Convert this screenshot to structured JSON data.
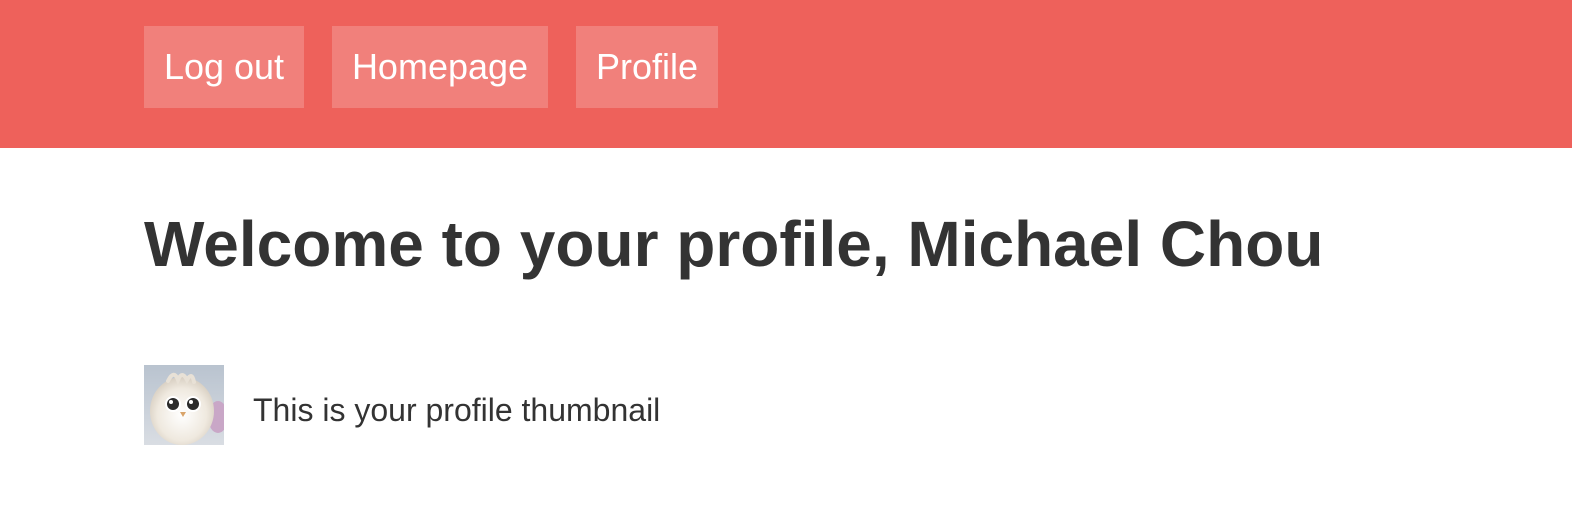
{
  "nav": {
    "logout_label": "Log out",
    "homepage_label": "Homepage",
    "profile_label": "Profile"
  },
  "main": {
    "title": "Welcome to your profile, Michael Chou",
    "thumbnail_caption": "This is your profile thumbnail",
    "avatar_icon": "fluffy-bird-avatar"
  },
  "colors": {
    "header_background": "#ee615b",
    "text": "#333333",
    "nav_text": "#ffffff"
  }
}
